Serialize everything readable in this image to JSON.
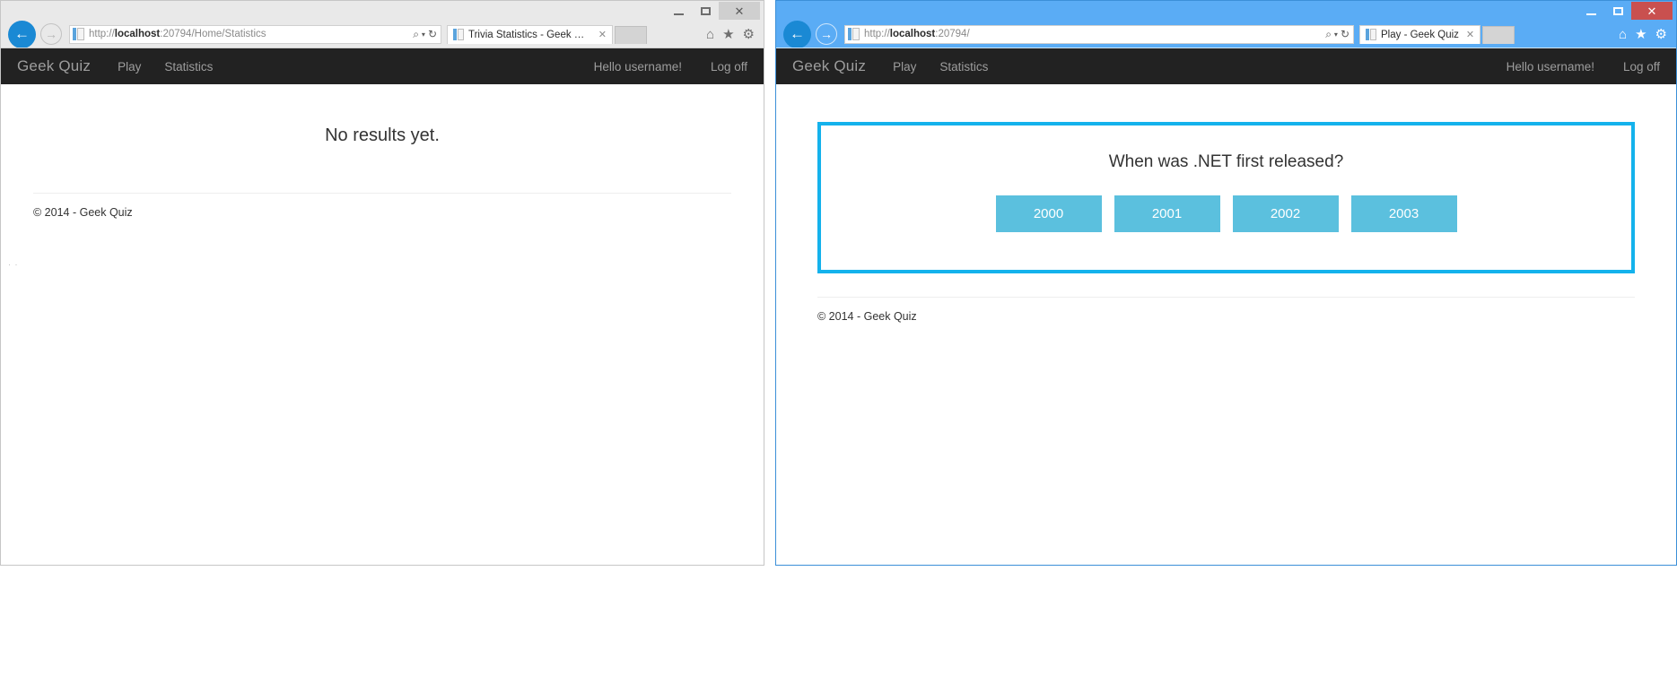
{
  "windows": [
    {
      "state": "inactive",
      "controls": {
        "minimize": "–",
        "maximize": "□",
        "close": "✕"
      },
      "toolbar": {
        "back_icon": "←",
        "forward_icon": "→",
        "url_host": "localhost",
        "url_rest": ":20794/Home/Statistics",
        "url_scheme": "http://",
        "search_icon": "⌕",
        "caret_icon": "▾",
        "refresh_icon": "↻",
        "home_icon": "⌂",
        "favorites_icon": "★",
        "settings_icon": "⚙"
      },
      "tab": {
        "title": "Trivia Statistics - Geek Quiz",
        "close": "✕"
      },
      "site": {
        "brand": "Geek Quiz",
        "nav": [
          {
            "label": "Play"
          },
          {
            "label": "Statistics"
          }
        ],
        "user_greeting": "Hello username!",
        "logoff": "Log off",
        "message": "No results yet.",
        "footer": "© 2014 - Geek Quiz"
      }
    },
    {
      "state": "active",
      "controls": {
        "minimize": "–",
        "maximize": "□",
        "close": "✕"
      },
      "toolbar": {
        "back_icon": "←",
        "forward_icon": "→",
        "url_host": "localhost",
        "url_rest": ":20794/",
        "url_scheme": "http://",
        "search_icon": "⌕",
        "caret_icon": "▾",
        "refresh_icon": "↻",
        "home_icon": "⌂",
        "favorites_icon": "★",
        "settings_icon": "⚙"
      },
      "tab": {
        "title": "Play - Geek Quiz",
        "close": "✕"
      },
      "site": {
        "brand": "Geek Quiz",
        "nav": [
          {
            "label": "Play"
          },
          {
            "label": "Statistics"
          }
        ],
        "user_greeting": "Hello username!",
        "logoff": "Log off",
        "question": "When was .NET first released?",
        "answers": [
          {
            "label": "2000"
          },
          {
            "label": "2001"
          },
          {
            "label": "2002"
          },
          {
            "label": "2003"
          }
        ],
        "footer": "© 2014 - Geek Quiz"
      }
    }
  ],
  "colors": {
    "navbar_bg": "#222222",
    "quiz_border": "#14b2ec",
    "answer_bg": "#5bc0de",
    "active_chrome": "#5aacf5",
    "close_red": "#c9504f",
    "back_blue": "#1a89d4"
  },
  "resize_dots": "· ·"
}
